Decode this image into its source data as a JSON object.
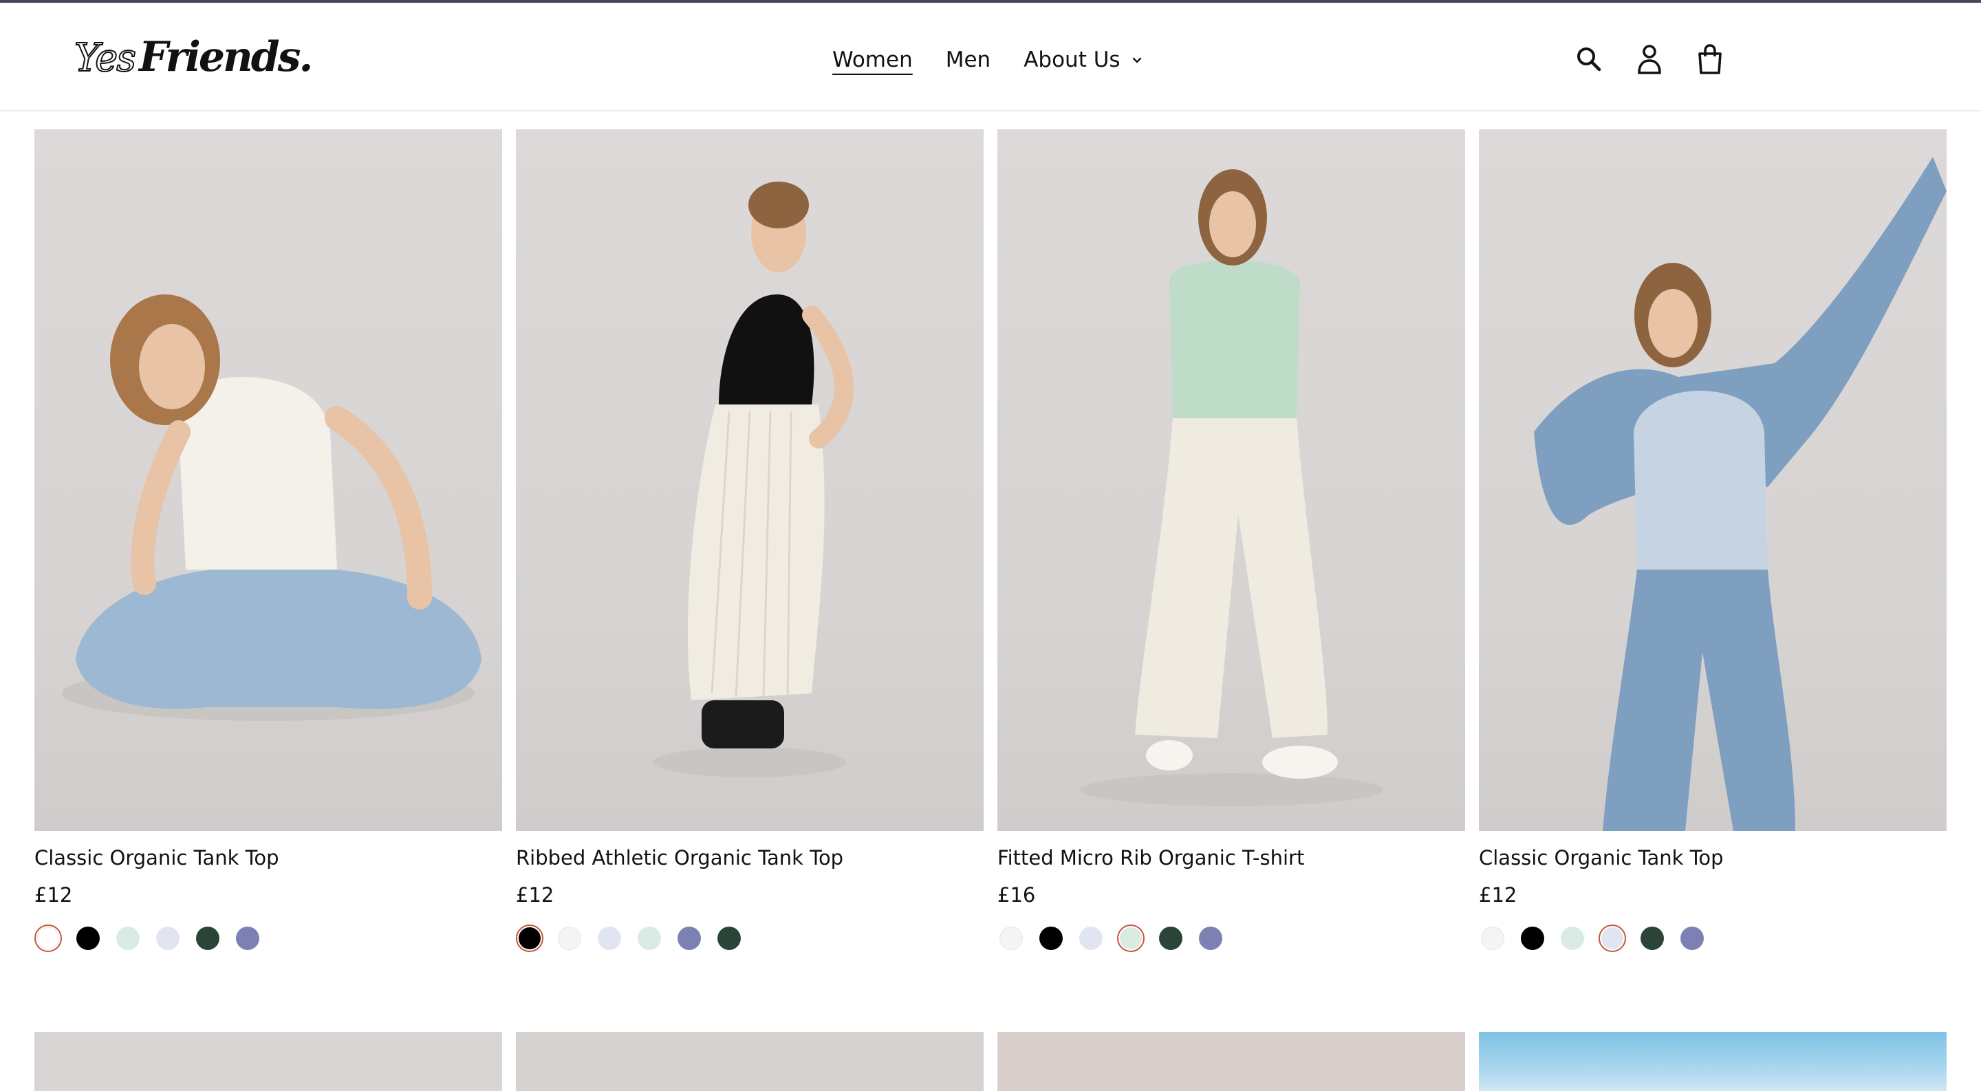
{
  "brand": {
    "logo_yes": "Yes",
    "logo_friends": "Friends."
  },
  "nav": {
    "items": [
      {
        "label": "Women",
        "active": true
      },
      {
        "label": "Men",
        "active": false
      },
      {
        "label": "About Us",
        "active": false,
        "dropdown": true
      }
    ]
  },
  "header_icons": [
    "search-icon",
    "account-icon",
    "cart-icon"
  ],
  "products": [
    {
      "title": "Classic Organic Tank Top",
      "price": "£12",
      "swatches": [
        "#ffffff",
        "#000000",
        "#d9ebe3",
        "#e1e5f2",
        "#2a4437",
        "#7b82b3"
      ],
      "selected": 0,
      "garment_top": "#f4f1ea",
      "garment_bottom": "#9db8d3"
    },
    {
      "title": "Ribbed Athletic Organic Tank Top",
      "price": "£12",
      "swatches": [
        "#000000",
        "#f5f4f4",
        "#e1e5f2",
        "#d9ebe3",
        "#7b82b3",
        "#2a4437"
      ],
      "selected": 0,
      "garment_top": "#111111",
      "garment_bottom": "#f1ece2"
    },
    {
      "title": "Fitted Micro Rib Organic T-shirt",
      "price": "£16",
      "swatches": [
        "#f5f4f4",
        "#000000",
        "#e1e5f2",
        "#d9ebe3",
        "#2a4437",
        "#7b82b3"
      ],
      "selected": 3,
      "garment_top": "#bfdcc9",
      "garment_bottom": "#efebe1"
    },
    {
      "title": "Classic Organic Tank Top",
      "price": "£12",
      "swatches": [
        "#f5f4f4",
        "#000000",
        "#d9ebe3",
        "#e1e5f2",
        "#2a4437",
        "#7b82b3"
      ],
      "selected": 3,
      "garment_top": "#c6d3e2",
      "garment_bottom": "#7f9fc0"
    }
  ],
  "colors": {
    "accent_selected": "#c8553d",
    "text": "#121212"
  }
}
